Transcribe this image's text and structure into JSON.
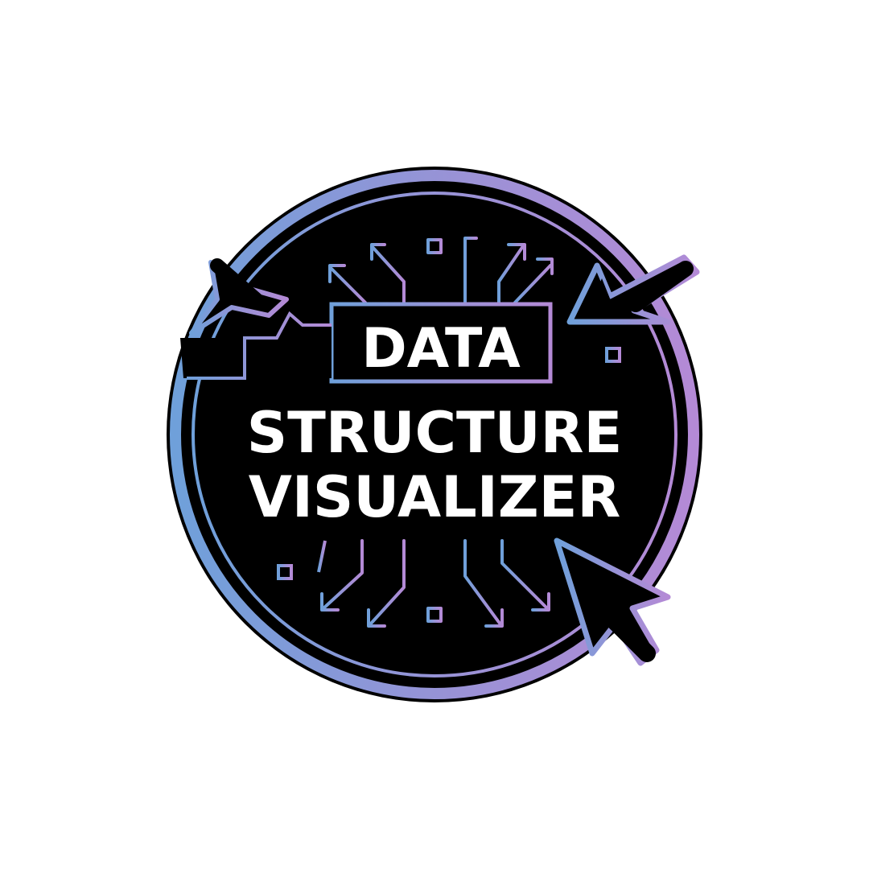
{
  "logo": {
    "line1": "DATA",
    "line2": "STRUCTURE",
    "line3": "VISUALIZER"
  },
  "colors": {
    "background": "#ffffff",
    "badge_fill": "#000000",
    "text": "#ffffff",
    "gradient_start": "#6fa0da",
    "gradient_mid": "#9a92d6",
    "gradient_end": "#b48ad6"
  },
  "icons": [
    "cursor-arrow-icon",
    "circuit-branch-icon"
  ]
}
